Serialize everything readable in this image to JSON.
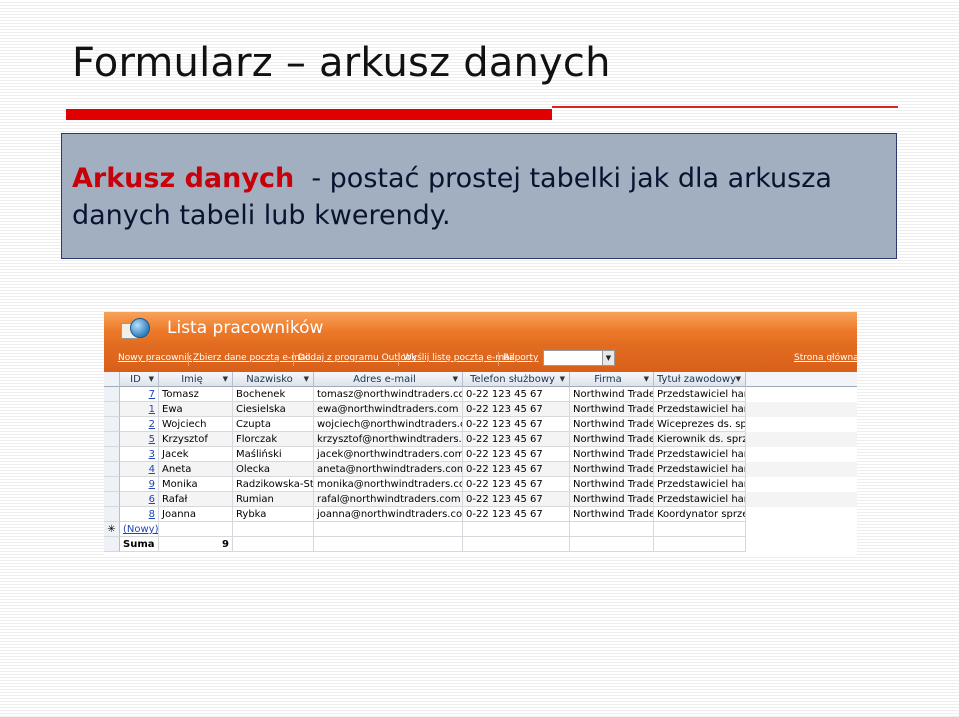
{
  "slide": {
    "title": "Formularz – arkusz danych",
    "highlight": "Arkusz danych",
    "body": "- postać prostej tabelki jak dla arkusza danych tabeli lub kwerendy."
  },
  "app": {
    "window_title": "Lista pracowników",
    "toolbar": {
      "new_employee": "Nowy pracownik",
      "collect_email": "Zbierz dane pocztą e-mail",
      "add_outlook": "Dodaj z programu Outlook",
      "send_list": "Wyślij listę pocztą e-mail",
      "reports": "Raporty",
      "reports_value": "",
      "home": "Strona główna"
    },
    "columns": [
      "ID",
      "Imię",
      "Nazwisko",
      "Adres e-mail",
      "Telefon służbowy",
      "Firma",
      "Tytuł zawodowy"
    ],
    "rows": [
      [
        "7",
        "Tomasz",
        "Bochenek",
        "tomasz@northwindtraders.com",
        "0-22 123 45 67",
        "Northwind Traders",
        "Przedstawiciel handlowy"
      ],
      [
        "1",
        "Ewa",
        "Ciesielska",
        "ewa@northwindtraders.com",
        "0-22 123 45 67",
        "Northwind Traders",
        "Przedstawiciel handlowy"
      ],
      [
        "2",
        "Wojciech",
        "Czupta",
        "wojciech@northwindtraders.com",
        "0-22 123 45 67",
        "Northwind Traders",
        "Wiceprezes ds. sprzedaży"
      ],
      [
        "5",
        "Krzysztof",
        "Florczak",
        "krzysztof@northwindtraders.com",
        "0-22 123 45 67",
        "Northwind Traders",
        "Kierownik ds. sprzedaży"
      ],
      [
        "3",
        "Jacek",
        "Maśliński",
        "jacek@northwindtraders.com",
        "0-22 123 45 67",
        "Northwind Traders",
        "Przedstawiciel handlowy"
      ],
      [
        "4",
        "Aneta",
        "Olecka",
        "aneta@northwindtraders.com",
        "0-22 123 45 67",
        "Northwind Traders",
        "Przedstawiciel handlowy"
      ],
      [
        "9",
        "Monika",
        "Radzikowska-Strzelecka",
        "monika@northwindtraders.com",
        "0-22 123 45 67",
        "Northwind Traders",
        "Przedstawiciel handlowy"
      ],
      [
        "6",
        "Rafał",
        "Rumian",
        "rafal@northwindtraders.com",
        "0-22 123 45 67",
        "Northwind Traders",
        "Przedstawiciel handlowy"
      ],
      [
        "8",
        "Joanna",
        "Rybka",
        "joanna@northwindtraders.com",
        "0-22 123 45 67",
        "Northwind Traders",
        "Koordynator sprzedaży"
      ]
    ],
    "new_record_symbol": "✳",
    "new_record_label": "(Nowy)",
    "total_label": "Suma",
    "total_value": "9"
  },
  "colors": {
    "title_bar": "#e00000",
    "highlight": "#c8000a",
    "callout_bg": "#a1afc0",
    "access_orange": "#ed7a2a"
  },
  "icons": {
    "app_icon": "access-globe-icon",
    "dropdown": "chevron-down-icon",
    "new_record": "asterisk-icon"
  }
}
